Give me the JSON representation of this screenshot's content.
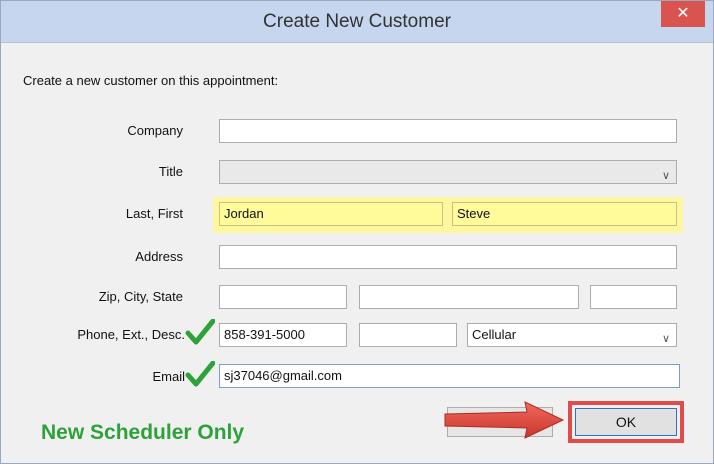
{
  "window": {
    "title": "Create New Customer",
    "close_glyph": "✕"
  },
  "form": {
    "prompt": "Create a new customer on this appointment:",
    "labels": {
      "company": "Company",
      "title": "Title",
      "last_first": "Last, First",
      "address": "Address",
      "zip_city_state": "Zip, City, State",
      "phone_ext_desc": "Phone, Ext., Desc.",
      "email": "Email"
    },
    "values": {
      "company": "",
      "title": "",
      "last_name": "Jordan",
      "first_name": "Steve",
      "address": "",
      "zip": "",
      "city": "",
      "state": "",
      "phone": "858-391-5000",
      "ext": "",
      "phone_desc": "Cellular",
      "email": "sj37046@gmail.com"
    }
  },
  "buttons": {
    "ok": "OK",
    "cancel": ""
  },
  "annotations": {
    "promo_text": "New Scheduler Only",
    "check_icon": "green-check-icon",
    "arrow_icon": "red-arrow-icon"
  },
  "colors": {
    "titlebar": "#c5d6ee",
    "close": "#d9534f",
    "highlight_yellow": "#fffa9a",
    "promo_green": "#2ea13a",
    "annotation_red": "#e04b4b"
  }
}
